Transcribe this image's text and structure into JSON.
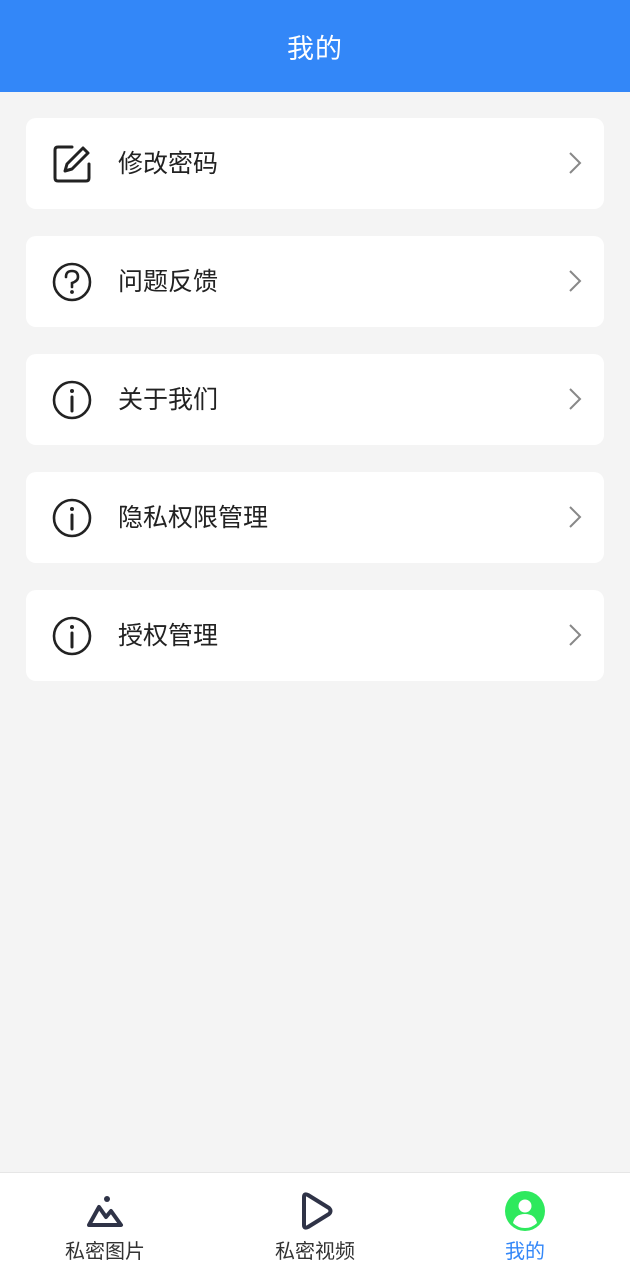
{
  "header": {
    "title": "我的"
  },
  "menu": {
    "items": [
      {
        "label": "修改密码",
        "icon": "edit-icon"
      },
      {
        "label": "问题反馈",
        "icon": "question-icon"
      },
      {
        "label": "关于我们",
        "icon": "info-icon"
      },
      {
        "label": "隐私权限管理",
        "icon": "info-icon"
      },
      {
        "label": "授权管理",
        "icon": "info-icon"
      }
    ]
  },
  "tabbar": {
    "tabs": [
      {
        "label": "私密图片",
        "icon": "mountain-photo-icon",
        "active": false
      },
      {
        "label": "私密视频",
        "icon": "play-icon",
        "active": false
      },
      {
        "label": "我的",
        "icon": "user-icon",
        "active": true
      }
    ]
  },
  "colors": {
    "brand": "#3387f8",
    "active_icon": "#2ee95d",
    "background": "#f4f4f4",
    "card": "#ffffff",
    "text": "#222222"
  }
}
